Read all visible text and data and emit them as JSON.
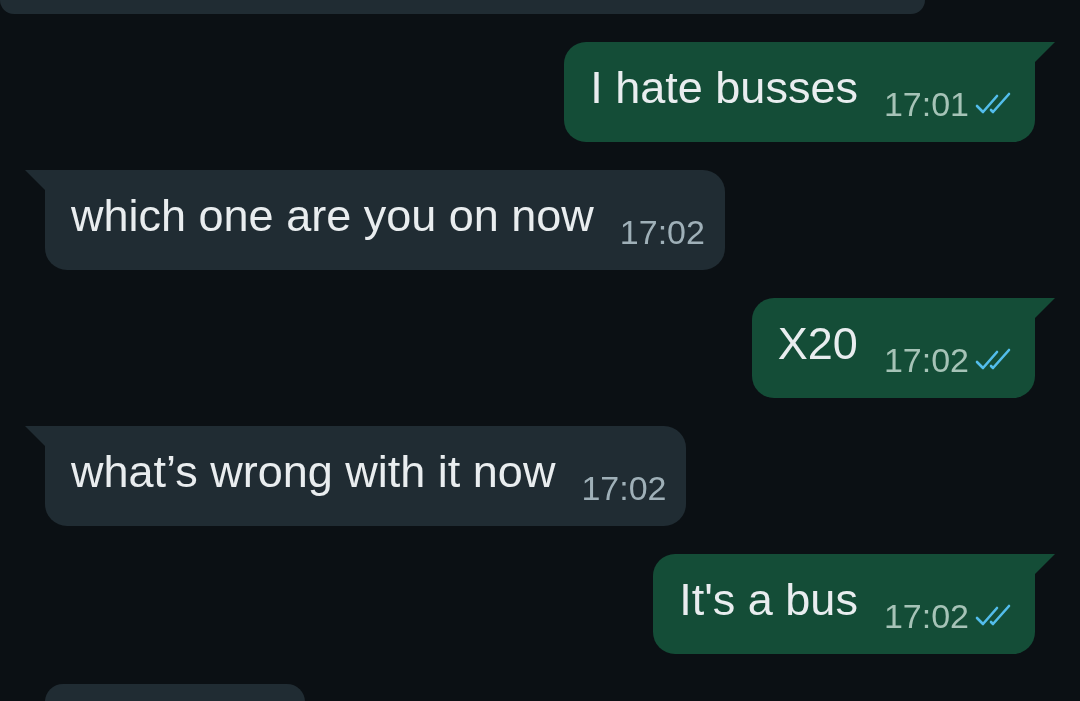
{
  "messages": [
    {
      "kind": "partial",
      "outgoing": false
    },
    {
      "kind": "text",
      "outgoing": true,
      "text": "I hate busses",
      "time": "17:01",
      "read": true
    },
    {
      "kind": "text",
      "outgoing": false,
      "text": "which one are you on now",
      "time": "17:02"
    },
    {
      "kind": "text",
      "outgoing": true,
      "text": "X20",
      "time": "17:02",
      "read": true
    },
    {
      "kind": "text",
      "outgoing": false,
      "text": "what’s wrong with it now",
      "time": "17:02"
    },
    {
      "kind": "text",
      "outgoing": true,
      "text": "It's a bus",
      "time": "17:02",
      "read": true
    },
    {
      "kind": "partial",
      "outgoing": false
    }
  ]
}
